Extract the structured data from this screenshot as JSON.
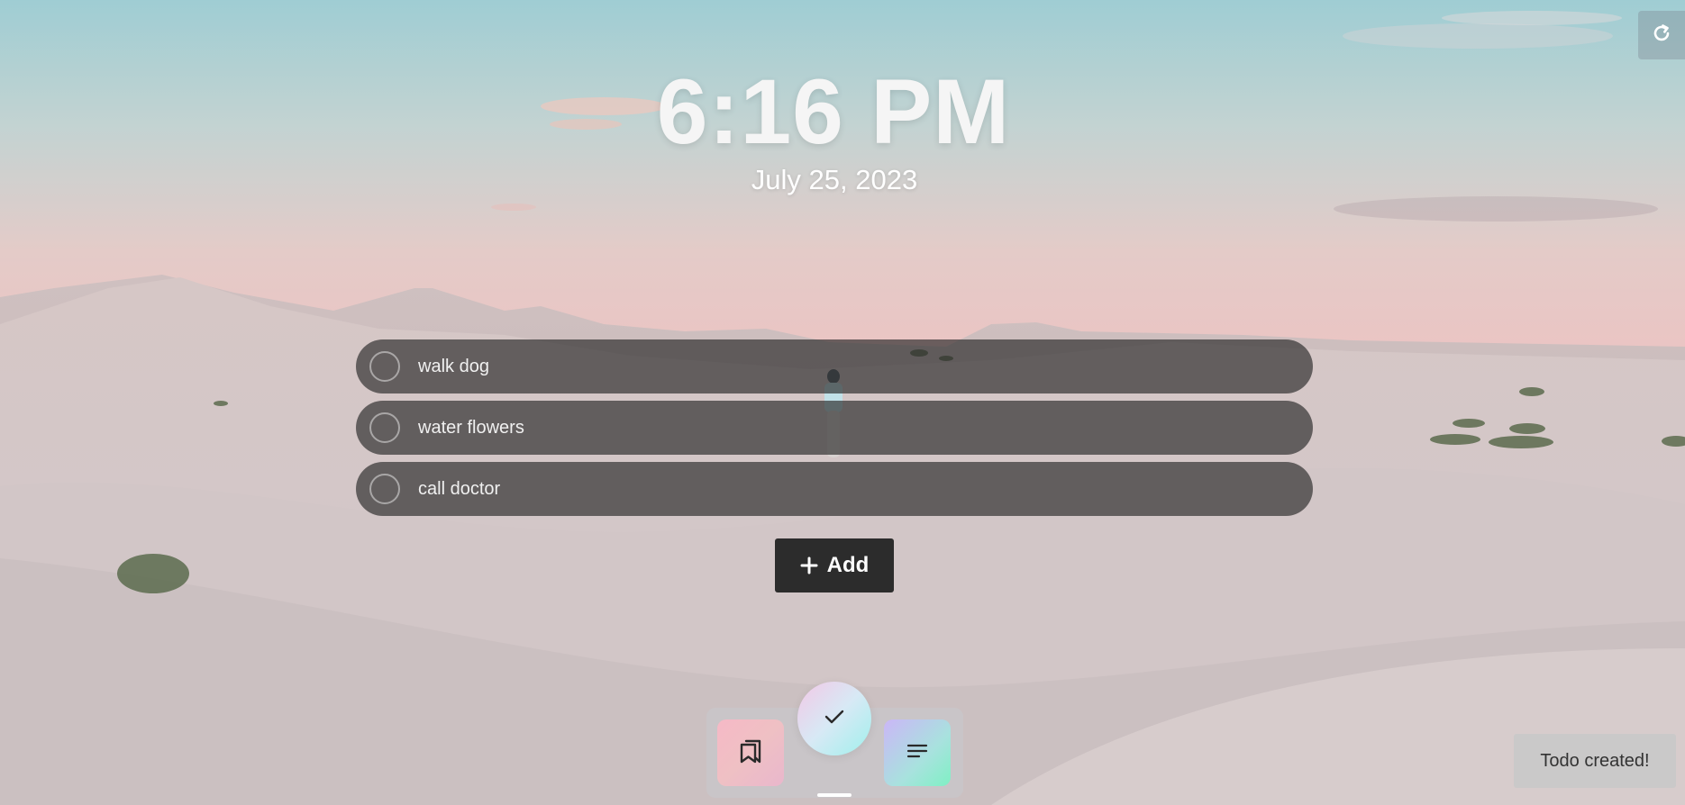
{
  "clock": {
    "time": "6:16 PM",
    "date": "July 25, 2023"
  },
  "todos": [
    {
      "text": "walk dog",
      "done": false
    },
    {
      "text": "water flowers",
      "done": false
    },
    {
      "text": "call doctor",
      "done": false
    }
  ],
  "actions": {
    "add_label": "Add"
  },
  "dock": {
    "items": [
      {
        "name": "bookmarks",
        "icon": "bookmarks-icon"
      },
      {
        "name": "todo",
        "icon": "checkmark-icon",
        "active": true
      },
      {
        "name": "notes",
        "icon": "notes-icon"
      }
    ]
  },
  "toast": {
    "message": "Todo created!"
  },
  "toolbar": {
    "refresh_icon": "refresh-icon"
  },
  "colors": {
    "todo_item_bg": "#282828a8",
    "add_button_bg": "#2c2c2c",
    "sky_top": "#9ccdd2",
    "sky_horizon": "#e9c3c2",
    "sand": "#d9cdcc"
  }
}
